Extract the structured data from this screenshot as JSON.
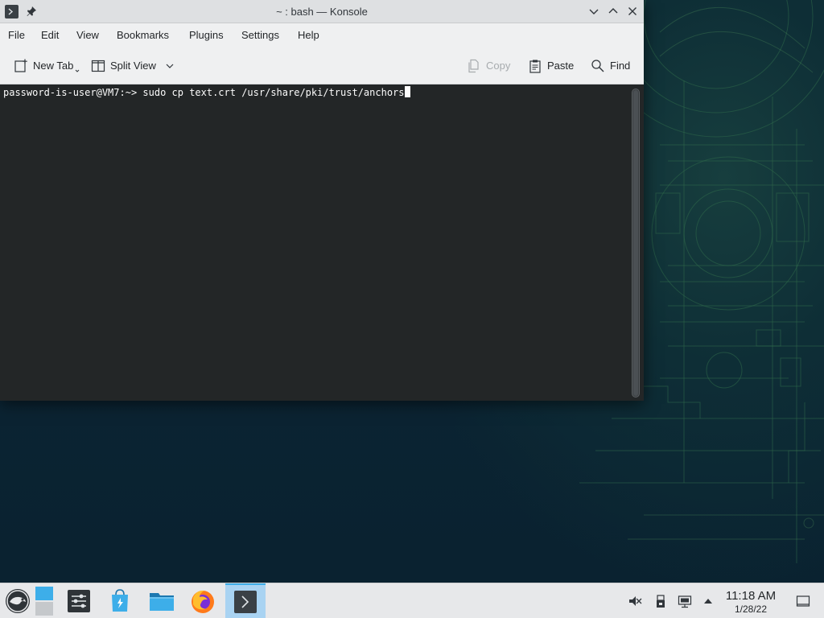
{
  "window": {
    "title": "~ : bash — Konsole"
  },
  "menubar": {
    "items": [
      "File",
      "Edit",
      "View",
      "Bookmarks",
      "Plugins",
      "Settings",
      "Help"
    ]
  },
  "toolbar": {
    "new_tab": "New Tab",
    "split_view": "Split View",
    "copy": "Copy",
    "paste": "Paste",
    "find": "Find",
    "copy_enabled": false
  },
  "terminal": {
    "prompt": "password-is-user@VM7:~> ",
    "command": "sudo cp text.crt /usr/share/pki/trust/anchors",
    "background": "#232627",
    "foreground": "#fcfcfc"
  },
  "taskbar": {
    "apps": [
      "opensuse-launcher-icon",
      "pager-icon",
      "system-settings-icon",
      "discover-store-icon",
      "dolphin-files-icon",
      "firefox-icon",
      "konsole-icon"
    ],
    "active_app": "konsole-icon",
    "tray": [
      "volume-muted-icon",
      "device-notifier-icon",
      "network-icon",
      "tray-expand-icon"
    ],
    "clock": {
      "time": "11:18 AM",
      "date": "1/28/22"
    },
    "show_desktop": "show-desktop-icon"
  },
  "colors": {
    "accent": "#3daee9",
    "titlebar": "#dee0e2",
    "chrome": "#eff0f1",
    "taskbar": "#e7e8ea"
  }
}
